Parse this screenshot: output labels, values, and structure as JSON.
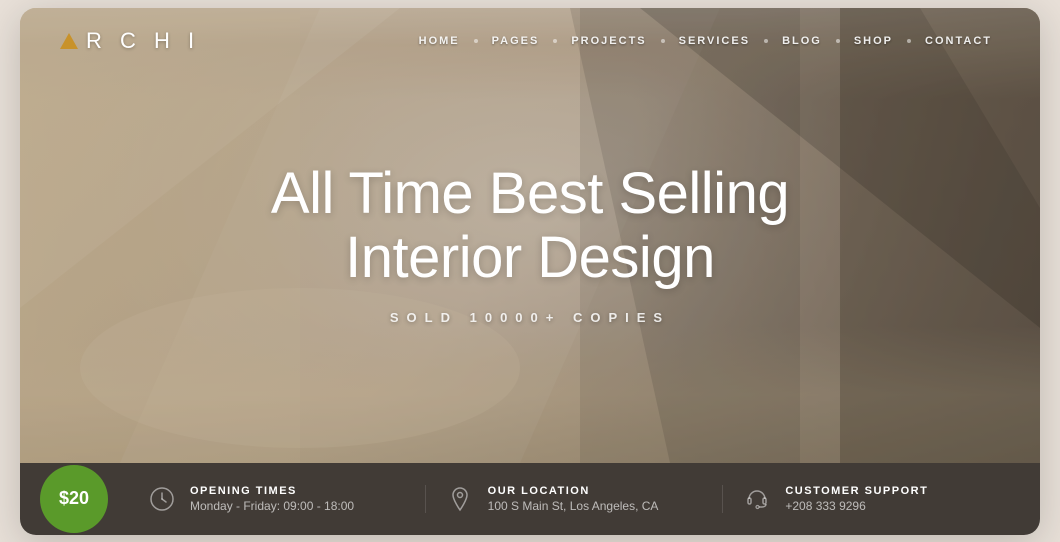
{
  "logo": {
    "text": "R C H I",
    "brand_color": "#c8922a"
  },
  "nav": {
    "items": [
      {
        "label": "HOME"
      },
      {
        "label": "PAGES"
      },
      {
        "label": "PROJECTS"
      },
      {
        "label": "SERVICES"
      },
      {
        "label": "BLOG"
      },
      {
        "label": "SHOP"
      },
      {
        "label": "CONTACT"
      }
    ]
  },
  "hero": {
    "title_line1": "All Time Best Selling",
    "title_line2": "Interior Design",
    "subtitle": "SOLD 10000+ COPIES"
  },
  "bottom_bar": {
    "price_badge": "$20",
    "info_items": [
      {
        "label": "OPENING TIMES",
        "value": "Monday - Friday: 09:00 - 18:00",
        "icon": "clock"
      },
      {
        "label": "OUR LOCATION",
        "value": "100 S Main St, Los Angeles, CA",
        "icon": "location"
      },
      {
        "label": "CUSTOMER SUPPORT",
        "value": "+208 333 9296",
        "icon": "headset"
      }
    ]
  }
}
